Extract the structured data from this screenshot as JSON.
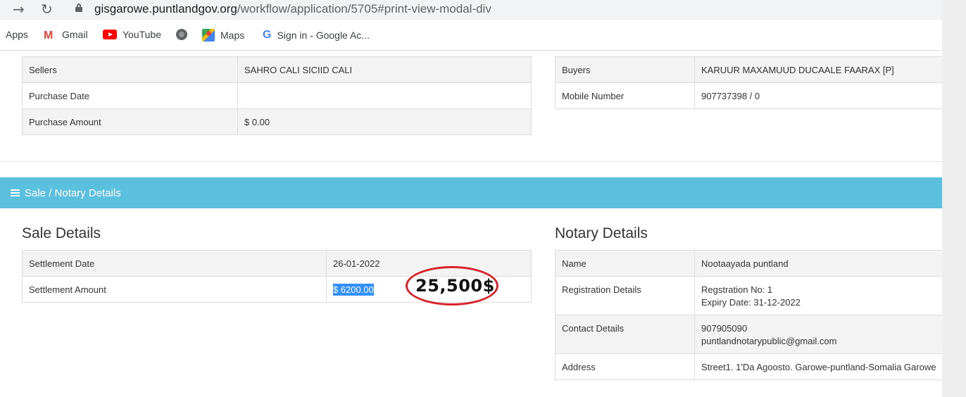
{
  "browser": {
    "url_host": "gisgarowe.puntlandgov.org",
    "url_path": "/workflow/application/5705#print-view-modal-div",
    "bookmarks": [
      {
        "label": "Apps",
        "icon": "apps-icon"
      },
      {
        "label": "Gmail",
        "icon": "gmail-icon"
      },
      {
        "label": "YouTube",
        "icon": "youtube-icon"
      },
      {
        "label": "",
        "icon": "globe-icon"
      },
      {
        "label": "Maps",
        "icon": "maps-icon"
      },
      {
        "label": "Sign in - Google Ac...",
        "icon": "google-icon"
      }
    ]
  },
  "seller_table": {
    "rows": [
      {
        "label": "Sellers",
        "value": "SAHRO CALI SICIID CALI"
      },
      {
        "label": "Purchase Date",
        "value": ""
      },
      {
        "label": "Purchase Amount",
        "value": "$ 0.00"
      }
    ]
  },
  "buyer_table": {
    "rows": [
      {
        "label": "Buyers",
        "value": "KARUUR MAXAMUUD DUCAALE FAARAX [P]"
      },
      {
        "label": "Mobile Number",
        "value": "907737398 / 0"
      }
    ]
  },
  "panel": {
    "title": "Sale / Notary Details",
    "accent_color": "#5bc0de"
  },
  "sale_details": {
    "title": "Sale Details",
    "rows": [
      {
        "label": "Settlement Date",
        "value": "26-01-2022"
      },
      {
        "label": "Settlement Amount",
        "value": "$ 6200.00"
      }
    ]
  },
  "notary_details": {
    "title": "Notary Details",
    "name_label": "Name",
    "name_value": "Nootaayada puntland",
    "registration_label": "Registration Details",
    "registration_line1": "Regstration No: 1",
    "registration_line2": "Expiry Date: 31-12-2022",
    "contact_label": "Contact Details",
    "contact_line1": "907905090",
    "contact_line2": "puntlandnotarypublic@gmail.com",
    "address_label": "Address",
    "address_value": "Street1. 1'Da Agoosto. Garowe-puntland-Somalia Garowe"
  },
  "annotation": {
    "text": "25,500$",
    "color": "#d8232a"
  }
}
